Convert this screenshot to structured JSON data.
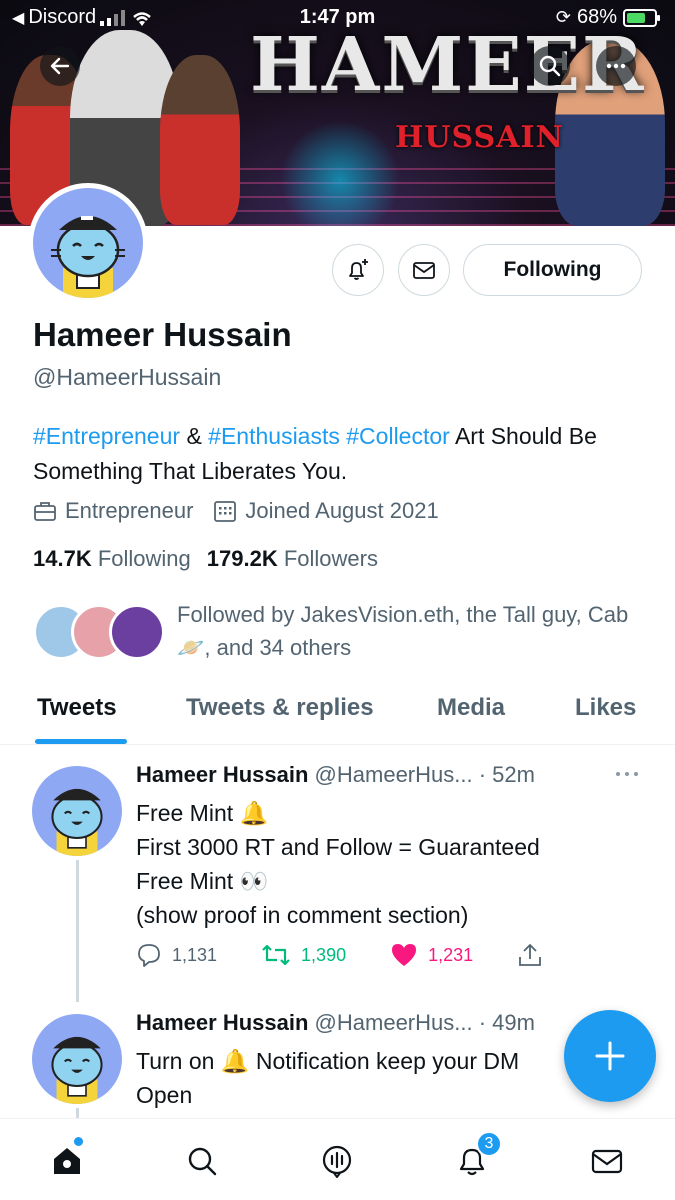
{
  "status_bar": {
    "back_app": "Discord",
    "time": "1:47 pm",
    "battery": "68%",
    "battery_level": 0.68
  },
  "banner": {
    "title": "HAMEER",
    "subtitle": "HUSSAIN"
  },
  "profile": {
    "name": "Hameer Hussain",
    "handle": "@HameerHussain",
    "bio_tags": [
      "#Entrepreneur",
      "#Enthusiasts",
      "#Collector"
    ],
    "bio_amp": "&",
    "bio_text": "Art Should Be Something That Liberates You.",
    "category": "Entrepreneur",
    "joined": "Joined August 2021",
    "following_count": "14.7K",
    "following_label": "Following",
    "followers_count": "179.2K",
    "followers_label": "Followers",
    "followed_by_prefix": "Followed by JakesVision.eth, the Tall guy, Cab",
    "followed_by_emoji": "🪐",
    "followed_by_suffix": ", and 34 others",
    "follow_button": "Following"
  },
  "tabs": [
    {
      "label": "Tweets",
      "active": true
    },
    {
      "label": "Tweets & replies",
      "active": false
    },
    {
      "label": "Media",
      "active": false
    },
    {
      "label": "Likes",
      "active": false
    }
  ],
  "tweets": [
    {
      "name": "Hameer Hussain",
      "handle": "@HameerHus...",
      "time": "· 52m",
      "line1": "Free Mint 🔔",
      "line2": "First 3000 RT and Follow  = Guaranteed",
      "line3": "Free Mint 👀",
      "line4": "(show proof in comment section)",
      "replies": "1,131",
      "retweets": "1,390",
      "likes": "1,231"
    },
    {
      "name": "Hameer Hussain",
      "handle": "@HameerHus...",
      "time": "· 49m",
      "line1": "Turn on 🔔 Notification keep your DM",
      "line2": "Open"
    }
  ],
  "nav": {
    "notifications_badge": "3"
  },
  "colors": {
    "accent": "#1d9bf0",
    "retweet": "#00ba7c",
    "like": "#f91880",
    "muted": "#536471"
  },
  "icons": [
    "back-arrow-icon",
    "search-icon",
    "more-icon",
    "bell-plus-icon",
    "mail-icon",
    "briefcase-icon",
    "calendar-icon",
    "reply-icon",
    "retweet-icon",
    "heart-icon",
    "share-icon",
    "compose-plus-icon",
    "home-icon",
    "search-icon",
    "spaces-icon",
    "bell-icon",
    "mail-icon"
  ]
}
